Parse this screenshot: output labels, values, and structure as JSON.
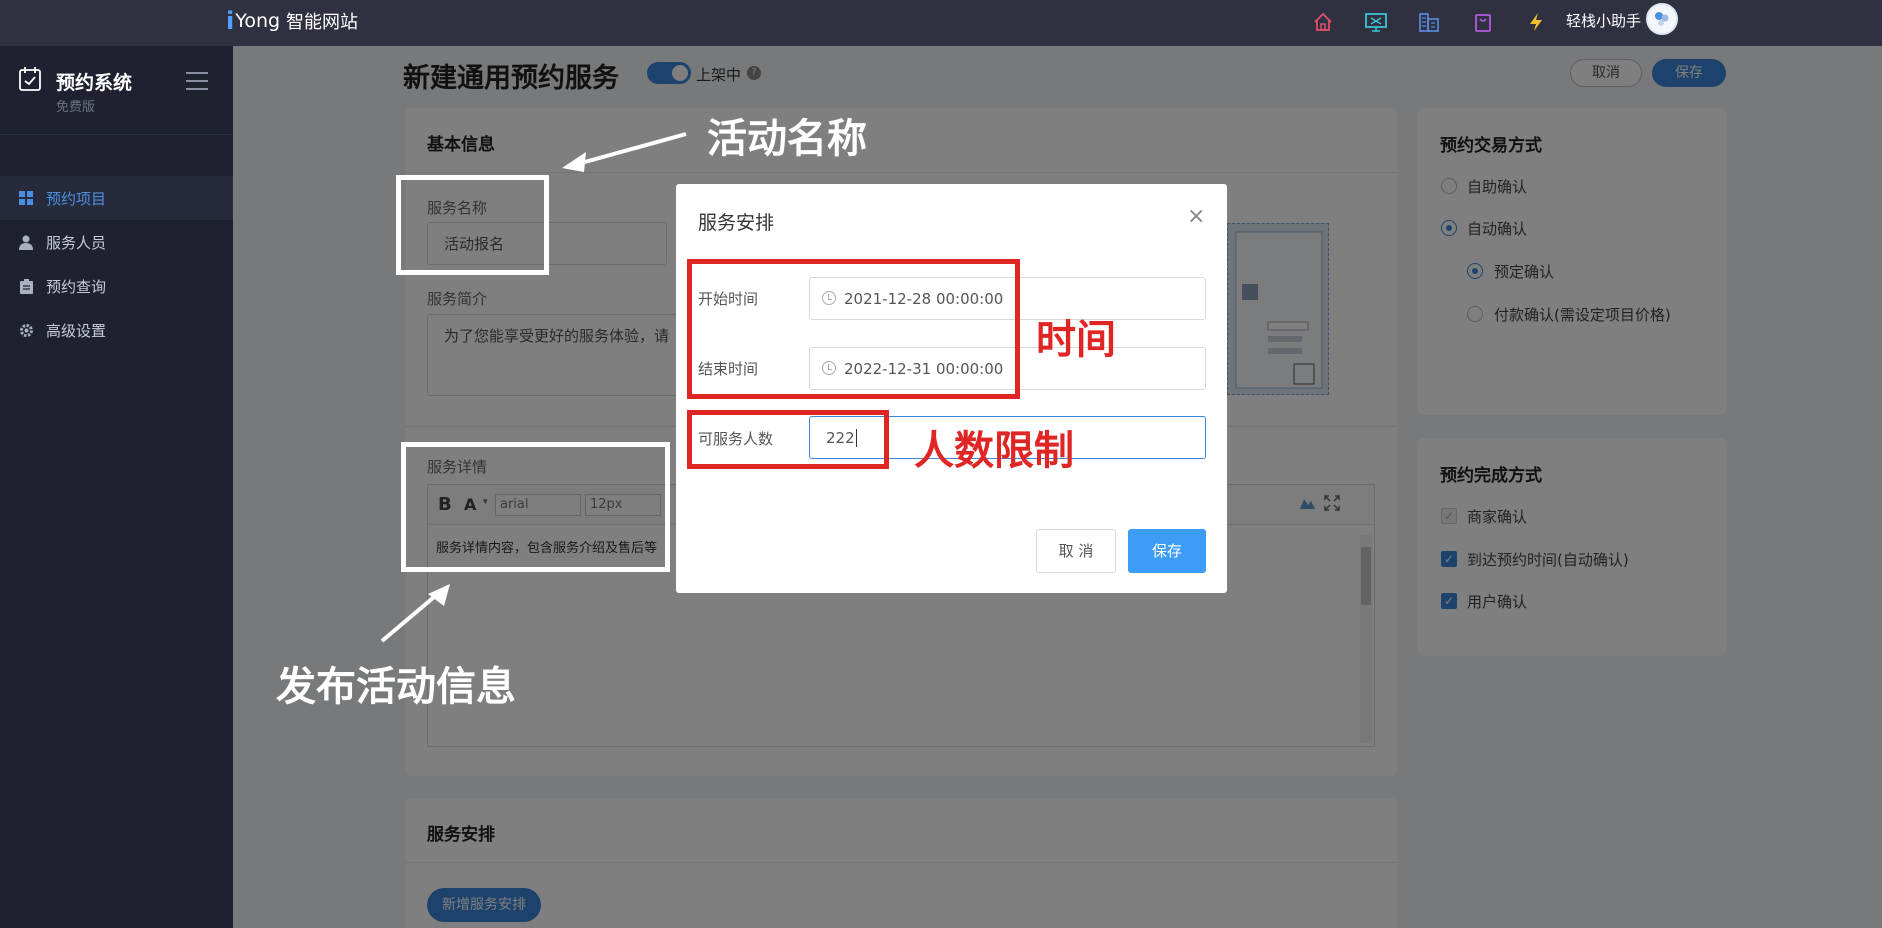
{
  "topbar": {
    "logo_mark": "i",
    "logo_text": "Yong",
    "logo_cn": "智能网站",
    "user_name": "轻栈小助手",
    "icons": [
      "home-icon",
      "monitor-icon",
      "building-icon",
      "bag-icon",
      "lightning-icon"
    ]
  },
  "sidebar": {
    "title": "预约系统",
    "subtitle": "免费版",
    "items": [
      {
        "label": "预约项目",
        "icon": "grid-icon",
        "active": true
      },
      {
        "label": "服务人员",
        "icon": "person-icon"
      },
      {
        "label": "预约查询",
        "icon": "clipboard-icon"
      },
      {
        "label": "高级设置",
        "icon": "gear-icon"
      }
    ]
  },
  "header": {
    "title": "新建通用预约服务",
    "toggle_label": "上架中",
    "help": "?",
    "cancel": "取消",
    "save": "保存"
  },
  "basic": {
    "title": "基本信息",
    "name_label": "服务名称",
    "name_value": "活动报名",
    "intro_label": "服务简介",
    "intro_value": "为了您能享受更好的服务体验，请",
    "detail_label": "服务详情",
    "editor_bold": "B",
    "editor_color": "A",
    "editor_font": "arial",
    "editor_size": "12px",
    "editor_content": "服务详情内容，包含服务介绍及售后等"
  },
  "schedule": {
    "title": "服务安排",
    "add_button": "新增服务安排"
  },
  "trade": {
    "title": "预约交易方式",
    "options": [
      "自助确认",
      "自动确认",
      "预定确认",
      "付款确认(需设定项目价格)"
    ]
  },
  "complete": {
    "title": "预约完成方式",
    "options": [
      "商家确认",
      "到达预约时间(自动确认)",
      "用户确认"
    ]
  },
  "modal": {
    "title": "服务安排",
    "close": "×",
    "start_label": "开始时间",
    "start_value": "2021-12-28 00:00:00",
    "end_label": "结束时间",
    "end_value": "2022-12-31 00:00:00",
    "capacity_label": "可服务人数",
    "capacity_value": "222",
    "cancel": "取 消",
    "save": "保存"
  },
  "annotations": {
    "activity_name": "活动名称",
    "publish_info": "发布活动信息",
    "time": "时间",
    "people_limit": "人数限制"
  },
  "colors": {
    "topbar": "#2f3140",
    "sidebar": "#1f2130",
    "accent": "#3a86d8",
    "annotation_red": "#e02525"
  }
}
